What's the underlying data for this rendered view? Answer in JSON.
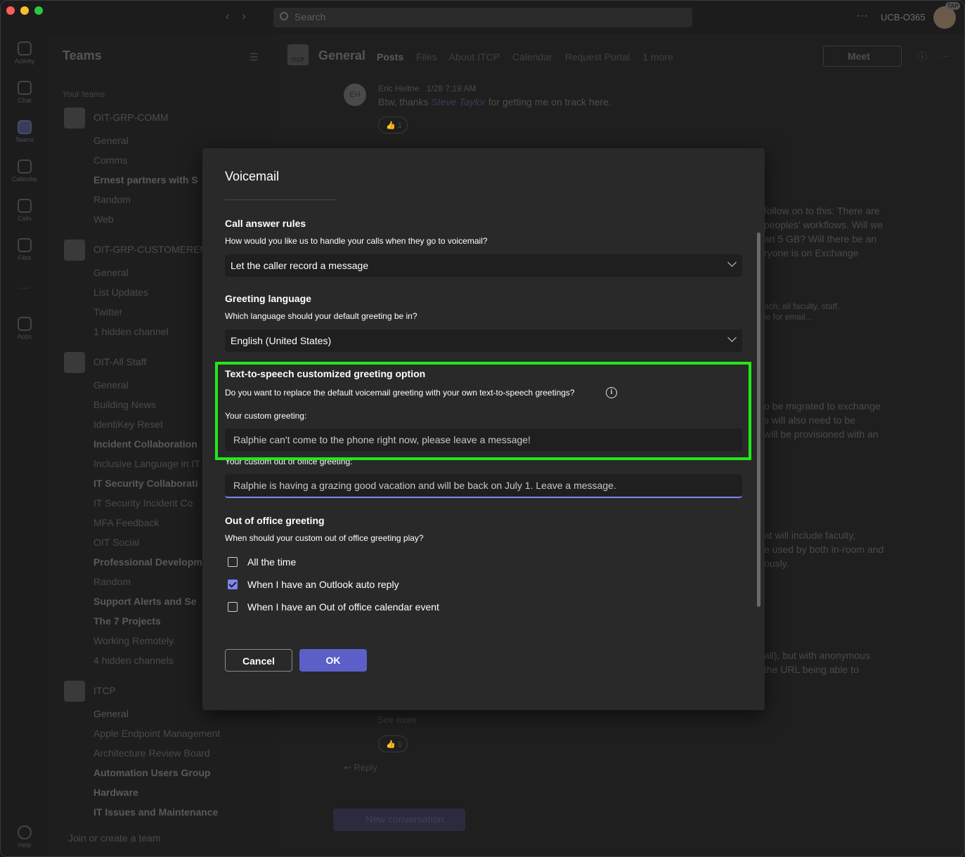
{
  "titlebar": {
    "search_placeholder": "Search",
    "org_name": "UCB-O365",
    "avatar_badge": "TAP"
  },
  "rail": {
    "items": [
      {
        "label": "Activity",
        "icon": "bell-icon"
      },
      {
        "label": "Chat",
        "icon": "chat-icon"
      },
      {
        "label": "Teams",
        "icon": "teams-icon"
      },
      {
        "label": "Calendar",
        "icon": "calendar-icon"
      },
      {
        "label": "Calls",
        "icon": "phone-icon"
      },
      {
        "label": "Files",
        "icon": "file-icon"
      },
      {
        "label": "Apps",
        "icon": "apps-icon"
      },
      {
        "label": "Help",
        "icon": "help-icon"
      }
    ]
  },
  "teams": {
    "title": "Teams",
    "section_label": "Your teams",
    "rows": [
      "OIT-GRP-COMM",
      "General",
      "Comms",
      "Ernest partners with S",
      "Random",
      "Web",
      "OIT-GRP-CUSTOMEREN",
      "General",
      "List Updates",
      "Twitter",
      "1 hidden channel",
      "OIT-All Staff",
      "General",
      "Building News",
      "IdentiKey Reset",
      "Incident Collaboration",
      "Inclusive Language in IT",
      "IT Security Collaborati",
      "IT Security Incident Co",
      "MFA Feedback",
      "OIT Social",
      "Professional Developm",
      "Random",
      "Support Alerts and Se",
      "The 7 Projects",
      "Working Remotely",
      "4 hidden channels",
      "ITCP",
      "General",
      "Apple Endpoint Management",
      "Architecture Review Board",
      "Automation Users Group",
      "Hardware",
      "IT Issues and Maintenance"
    ],
    "join_label": "Join or create a team"
  },
  "channel": {
    "logo_text": "ITCP",
    "name": "General",
    "tabs": [
      "Posts",
      "Files",
      "About ITCP",
      "Calendar",
      "Request Portal",
      "1 more"
    ],
    "meet_label": "Meet",
    "message": {
      "avatar_initials": "EH",
      "author": "Eric Heltne",
      "time": "1/28 7:19 AM",
      "text_before": "Btw, thanks",
      "mention": "Steve Taylor",
      "text_after": "for getting me on track here.",
      "reaction_count": "1"
    },
    "reply_label": "Reply",
    "see_more": "See more",
    "bg_snippets": [
      "follow on to this: There are",
      "peoples' workflows. Will we",
      "an 5 GB? Will there be an",
      "ryone is on Exchange",
      "ach, all faculty, staff,",
      "le for email...",
      "o be migrated to exchange",
      "s will also need to be",
      "will be provisioned with an",
      "at will include faculty,",
      "e used by both in-room and",
      "ously.",
      "all), but with anonymous",
      "the URL being able to"
    ],
    "new_conversation": "New conversation"
  },
  "dialog": {
    "title": "Voicemail",
    "call_rules": {
      "title": "Call answer rules",
      "desc": "How would you like us to handle your calls when they go to voicemail?",
      "value": "Let the caller record a message"
    },
    "greeting_lang": {
      "title": "Greeting language",
      "desc": "Which language should your default greeting be in?",
      "value": "English (United States)"
    },
    "tts": {
      "title": "Text-to-speech customized greeting option",
      "desc": "Do you want to replace the default voicemail greeting with your own text-to-speech greetings?",
      "custom_label": "Your custom greeting:",
      "custom_value": "Ralphie can't come to the phone right now, please leave a message!",
      "ooo_label": "Your custom out of office greeting:",
      "ooo_value": "Ralphie is having a grazing good vacation and will be back on July 1. Leave a message."
    },
    "ooo": {
      "title": "Out of office greeting",
      "desc": "When should your custom out of office greeting play?",
      "options": [
        {
          "label": "All the time",
          "checked": false
        },
        {
          "label": "When I have an Outlook auto reply",
          "checked": true
        },
        {
          "label": "When I have an Out of office calendar event",
          "checked": false
        }
      ]
    },
    "cancel_label": "Cancel",
    "ok_label": "OK"
  },
  "colors": {
    "accent": "#5b5fc7",
    "highlight_box": "#22e81a",
    "dialog_bg": "#292929"
  }
}
